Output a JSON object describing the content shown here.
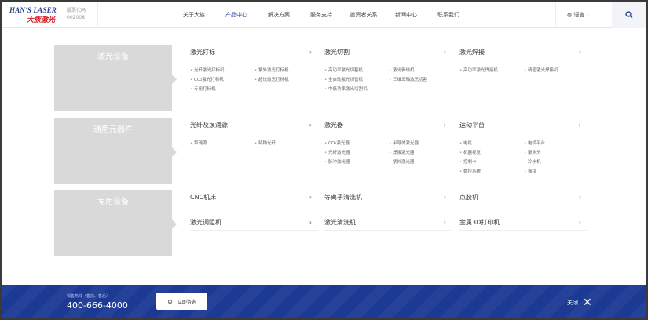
{
  "header": {
    "logo_en": "HAN'S LASER",
    "logo_cn": "大族激光",
    "stock_label": "股票代码",
    "stock_code": "002008",
    "nav": [
      "关于大族",
      "产品中心",
      "解决方案",
      "服务支持",
      "投资者关系",
      "新闻中心",
      "联系我们"
    ],
    "active_nav": 1,
    "language": "语言"
  },
  "rows": [
    {
      "title": "激光设备",
      "cols": [
        {
          "title": "激光打标",
          "items": [
            "光纤激光打标机",
            "紫外激光打标机",
            "CO₂激光打标机",
            "超快激光打标机",
            "专用打标机"
          ]
        },
        {
          "title": "激光切割",
          "items": [
            "高功率激光切割机",
            "激光剥线机",
            "全自动激光切管机",
            "三维五轴激光切割",
            "中低功率激光切割机"
          ]
        },
        {
          "title": "激光焊接",
          "items": [
            "高功率激光焊接机",
            "精密激光焊接机"
          ]
        }
      ]
    },
    {
      "title": "通用元器件",
      "cols": [
        {
          "title": "光纤及泵浦源",
          "items": [
            "泵浦源",
            "特种光纤"
          ]
        },
        {
          "title": "激光器",
          "items": [
            "CO₂激光器",
            "半导体激光器",
            "光纤激光器",
            "焊接激光器",
            "脉冲激光器",
            "紫外激光器"
          ]
        },
        {
          "title": "运动平台",
          "items": [
            "电机",
            "电机平台",
            "机器视觉",
            "聚焦头",
            "控制卡",
            "冷水机",
            "数控系统",
            "振镜"
          ]
        }
      ]
    },
    {
      "title": "专用设备",
      "cols": [
        {
          "title": "CNC机床",
          "items": []
        },
        {
          "title": "等离子清洗机",
          "items": []
        },
        {
          "title": "点胶机",
          "items": []
        }
      ],
      "cols2": [
        {
          "title": "激光调阻机"
        },
        {
          "title": "激光清洗机"
        },
        {
          "title": "金属3D打印机"
        }
      ]
    }
  ],
  "footer": {
    "hotline_label": "销售热线（售前、售后）",
    "phone": "400-666-4000",
    "consult": "立即咨询",
    "close": "关闭"
  }
}
